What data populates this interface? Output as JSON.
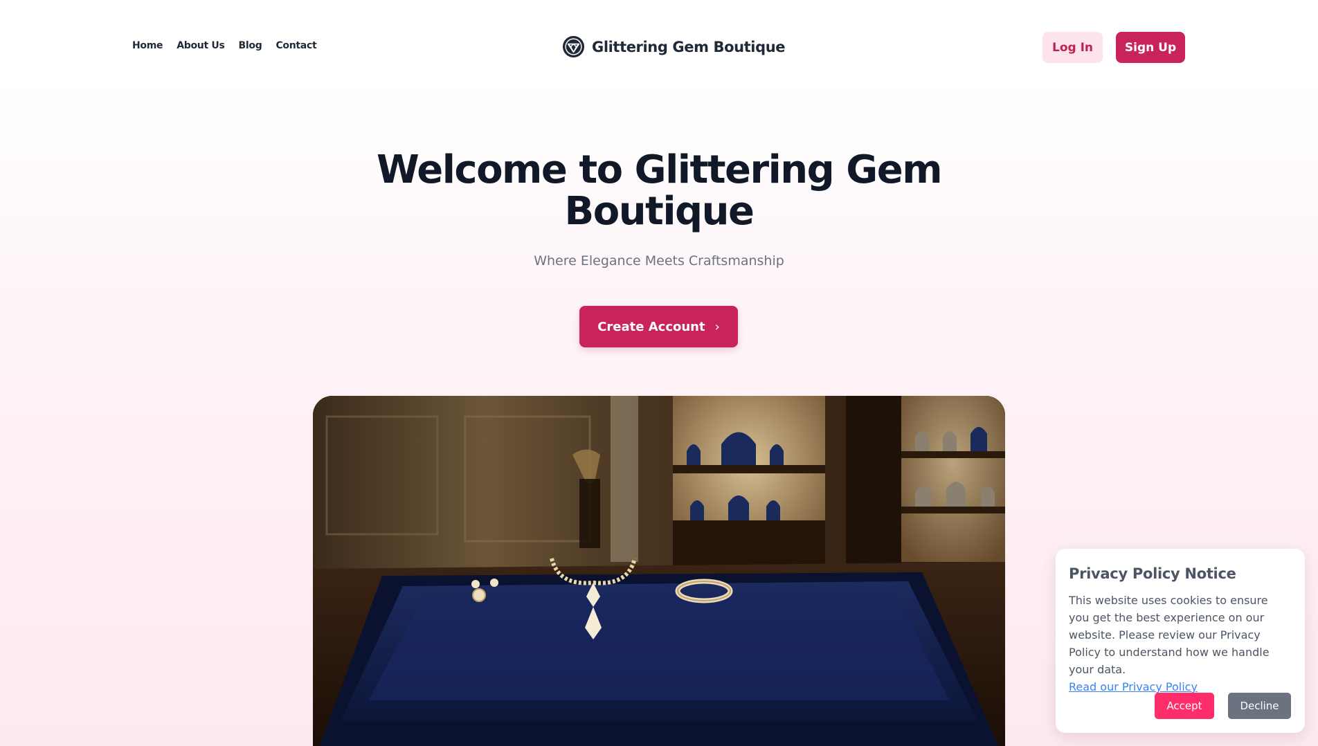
{
  "nav": {
    "items": [
      "Home",
      "About Us",
      "Blog",
      "Contact"
    ]
  },
  "brand": {
    "name": "Glittering Gem Boutique",
    "logo_icon": "gem-logo-icon"
  },
  "auth": {
    "login_label": "Log In",
    "signup_label": "Sign Up"
  },
  "hero": {
    "title_line1": "Welcome to Glittering Gem",
    "title_line2": "Boutique",
    "subtitle": "Where Elegance Meets Craftsmanship",
    "cta_label": "Create Account",
    "cta_icon": "chevron-right-icon",
    "image_subject": "jewelry-display-photo"
  },
  "cookie": {
    "title": "Privacy Policy Notice",
    "body": "This website uses cookies to ensure you get the best experience on our website. Please review our Privacy Policy to understand how we handle your data.",
    "link_label": "Read our Privacy Policy",
    "accept_label": "Accept",
    "decline_label": "Decline"
  },
  "colors": {
    "accent": "#c8245a",
    "accept": "#ff2e6a",
    "decline": "#6b7280",
    "login_bg": "#fde4ec"
  }
}
